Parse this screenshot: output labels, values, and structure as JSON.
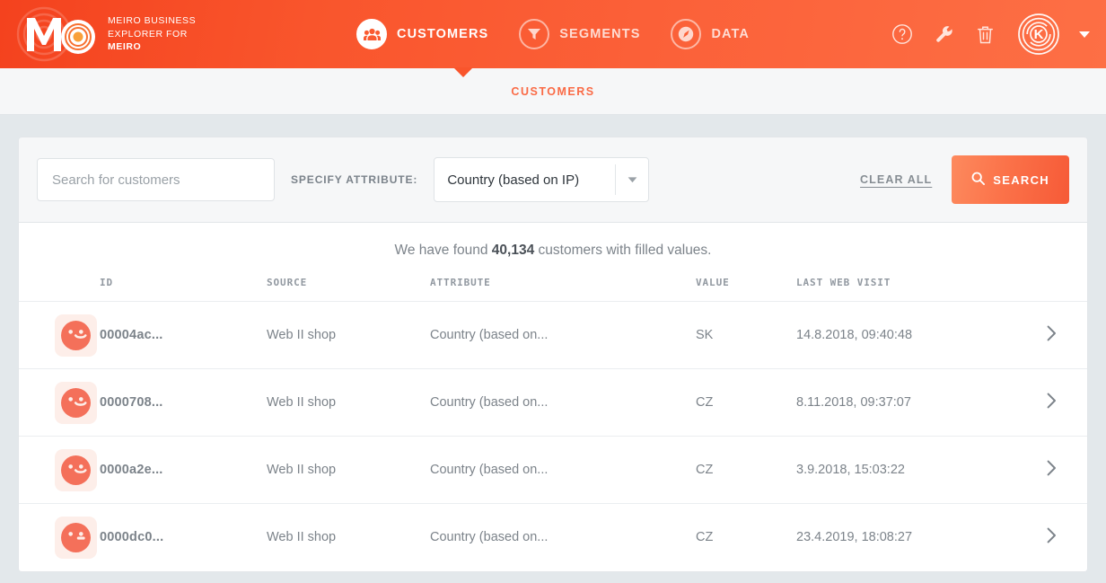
{
  "brand": {
    "line1": "MEIRO BUSINESS",
    "line2": "EXPLORER FOR",
    "line3": "MEIRO",
    "logo_icon": "meiro-logo-icon"
  },
  "topnav": {
    "items": [
      {
        "label": "CUSTOMERS",
        "icon": "people-icon",
        "active": true
      },
      {
        "label": "SEGMENTS",
        "icon": "funnel-icon",
        "active": false
      },
      {
        "label": "DATA",
        "icon": "gauge-icon",
        "active": false
      }
    ],
    "tools": [
      {
        "name": "help-icon",
        "glyph": "?"
      },
      {
        "name": "wrench-icon",
        "glyph": "⚒"
      },
      {
        "name": "trash-icon",
        "glyph": "Ὕ1"
      }
    ],
    "avatar_letter": "K",
    "avatar_caret": "chevron-down-icon"
  },
  "subnav": {
    "active_label": "CUSTOMERS"
  },
  "search": {
    "input_placeholder": "Search for customers",
    "input_value": "",
    "specify_label": "SPECIFY ATTRIBUTE:",
    "attribute_selected": "Country (based on IP)",
    "attribute_options": [
      "Country (based on IP)"
    ],
    "clear_label": "CLEAR ALL",
    "search_label": "SEARCH",
    "search_icon": "magnifier-icon"
  },
  "results": {
    "found_prefix": "We have found ",
    "found_count": "40,134",
    "found_suffix": " customers with filled values.",
    "columns": [
      "ID",
      "SOURCE",
      "ATTRIBUTE",
      "VALUE",
      "LAST WEB VISIT"
    ],
    "rows": [
      {
        "face": "smile",
        "id": "00004ac...",
        "source": "Web II shop",
        "attribute": "Country (based on...",
        "value": "SK",
        "last_web_visit": "14.8.2018, 09:40:48"
      },
      {
        "face": "smile",
        "id": "0000708...",
        "source": "Web II shop",
        "attribute": "Country (based on...",
        "value": "CZ",
        "last_web_visit": "8.11.2018, 09:37:07"
      },
      {
        "face": "smile",
        "id": "0000a2e...",
        "source": "Web II shop",
        "attribute": "Country (based on...",
        "value": "CZ",
        "last_web_visit": "3.9.2018, 15:03:22"
      },
      {
        "face": "neutral",
        "id": "0000dc0...",
        "source": "Web II shop",
        "attribute": "Country (based on...",
        "value": "CZ",
        "last_web_visit": "23.4.2019, 18:08:27"
      }
    ]
  },
  "colors": {
    "brand_orange": "#fa5a30",
    "brand_orange_deep": "#f4421e",
    "brand_orange_light": "#fd8a5e",
    "page_bg": "#e3e8eb",
    "card_bg": "#f6f7f8",
    "face_tile_bg": "#fdeee9",
    "face_fill": "#f4705a"
  }
}
